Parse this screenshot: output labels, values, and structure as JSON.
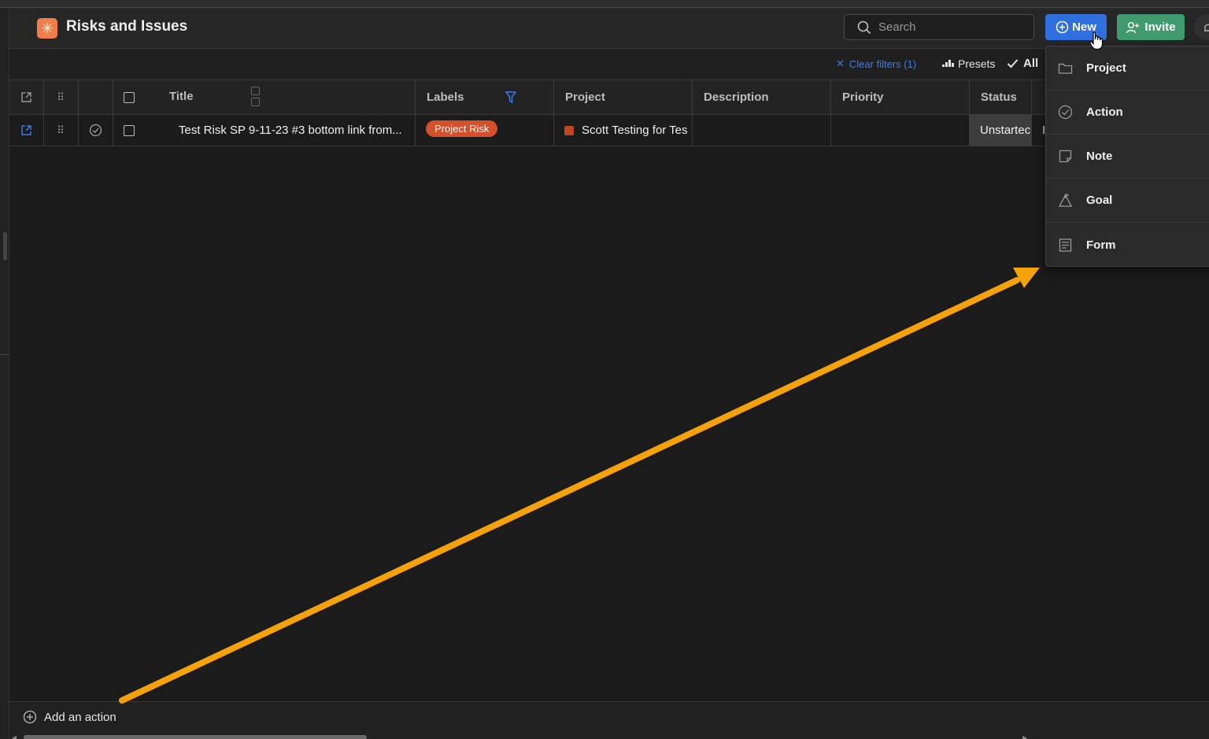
{
  "app": {
    "title": "Risks and Issues"
  },
  "search": {
    "placeholder": "Search",
    "value": ""
  },
  "header_buttons": {
    "new_label": "New",
    "invite_label": "Invite"
  },
  "toolbar": {
    "clear_filters": "Clear filters (1)",
    "presets": "Presets",
    "all_filter": "All"
  },
  "table": {
    "columns": [
      {
        "key": "title",
        "label": "Title"
      },
      {
        "key": "labels",
        "label": "Labels"
      },
      {
        "key": "project",
        "label": "Project"
      },
      {
        "key": "description",
        "label": "Description"
      },
      {
        "key": "priority",
        "label": "Priority"
      },
      {
        "key": "status",
        "label": "Status"
      }
    ],
    "rows": [
      {
        "title": "Test Risk SP 9-11-23 #3 bottom link from...",
        "labels": "Project Risk",
        "project": "Scott Testing for Tes",
        "description": "",
        "priority": "",
        "status": "Unstartec",
        "overflow": "I"
      }
    ]
  },
  "new_menu": {
    "items": [
      {
        "label": "Project",
        "icon": "folder-icon"
      },
      {
        "label": "Action",
        "icon": "check-circle-icon"
      },
      {
        "label": "Note",
        "icon": "note-icon"
      },
      {
        "label": "Goal",
        "icon": "goal-icon"
      },
      {
        "label": "Form",
        "icon": "form-icon"
      }
    ]
  },
  "footer": {
    "add_action": "Add an action"
  },
  "colors": {
    "accent_new": "#2f6fde",
    "accent_invite": "#3f9a6e",
    "label_project_risk": "#d4502b",
    "project_swatch": "#c0461f",
    "annotation_arrow": "#f5a20a",
    "link_blue": "#3a7cf0"
  }
}
